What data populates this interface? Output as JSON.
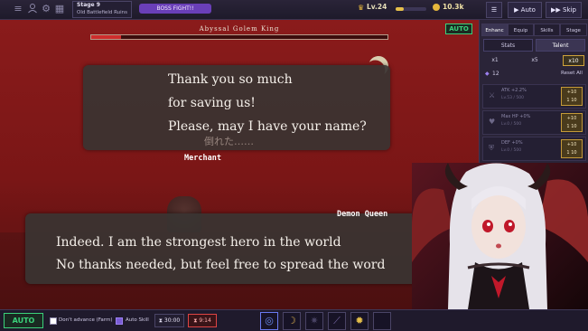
{
  "topbar": {
    "icons": [
      "menu-icon",
      "user-icon",
      "gear-icon",
      "grid-icon"
    ],
    "stage_label": "Stage 9",
    "stage_name": "Old Battlefield Ruins",
    "boss_button": "BOSS FIGHT!!",
    "level": "Lv.24",
    "level_progress": 0.25,
    "gold": "10.3k",
    "auto_label": "▶ Auto",
    "skip_label": "▶▶ Skip"
  },
  "battle": {
    "boss_name": "Abyssal Golem King",
    "boss_hp_fraction": 0.1,
    "auto_badge": "AUTO"
  },
  "dialog_top": {
    "lines": [
      "Thank you so much",
      "for saving us!",
      "Please, may I have your name?"
    ],
    "ghost_text": "倒れた……",
    "speaker": "Merchant"
  },
  "dialog_bottom": {
    "speaker": "Demon Queen",
    "lines": [
      "Indeed. I am the strongest hero in the world",
      "No thanks needed, but feel free to spread the word"
    ]
  },
  "sidebar": {
    "tabs": [
      "Enhanc",
      "Equip",
      "Skills",
      "Stage"
    ],
    "subtabs": [
      "Stats",
      "Talent"
    ],
    "multipliers": [
      "x1",
      "x5",
      "x10"
    ],
    "points": "12",
    "reset_label": "Reset All",
    "stats": [
      {
        "label": "ATK +2.2%",
        "sub": "Lv.53 / 500",
        "btn_top": "+10",
        "btn_bot": "1 10"
      },
      {
        "label": "Max HP +0%",
        "sub": "Lv.0 / 500",
        "btn_top": "+10",
        "btn_bot": "1 10"
      },
      {
        "label": "DEF +0%",
        "sub": "Lv.0 / 500",
        "btn_top": "+10",
        "btn_bot": "1 10"
      }
    ]
  },
  "bottombar": {
    "auto_label": "AUTO",
    "dont_advance_label": "Don't advance (Farm)",
    "auto_skill_label": "Auto Skill",
    "timer1": "30:00",
    "timer2": "9:14"
  }
}
